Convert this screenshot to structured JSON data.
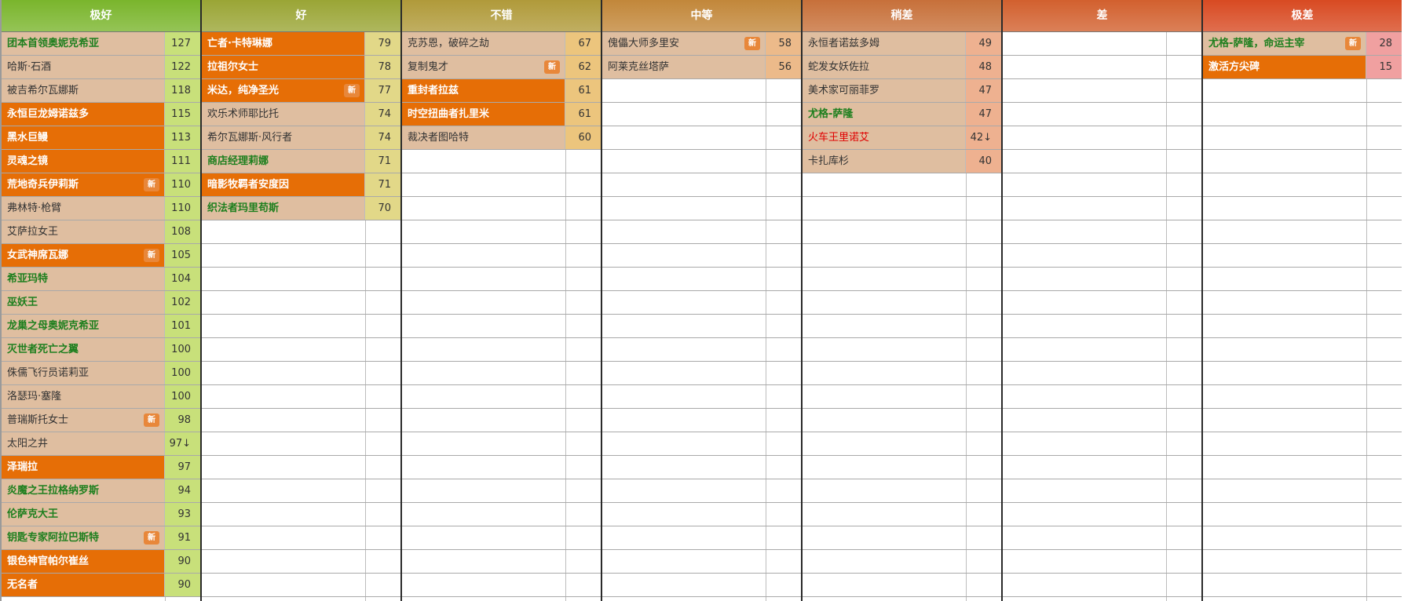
{
  "columns": [
    {
      "title": "极好",
      "header_color": "#7ab52c",
      "score_bg": "#c8e07a",
      "rows": [
        {
          "name": "团本首领奥妮克希亚",
          "score": "127",
          "style": "green"
        },
        {
          "name": "哈斯·石酒",
          "score": "122",
          "style": "regular"
        },
        {
          "name": "被吉希尔瓦娜斯",
          "score": "118",
          "style": "regular"
        },
        {
          "name": "永恒巨龙姆诺兹多",
          "score": "115",
          "style": "orange"
        },
        {
          "name": "黑水巨鳗",
          "score": "113",
          "style": "orange"
        },
        {
          "name": "灵魂之镜",
          "score": "111",
          "style": "orange"
        },
        {
          "name": "荒地奇兵伊莉斯",
          "score": "110",
          "style": "orange",
          "badge": "新"
        },
        {
          "name": "弗林特·枪臂",
          "score": "110",
          "style": "regular"
        },
        {
          "name": "艾萨拉女王",
          "score": "108",
          "style": "regular"
        },
        {
          "name": "女武神席瓦娜",
          "score": "105",
          "style": "orange",
          "badge": "新"
        },
        {
          "name": "希亚玛特",
          "score": "104",
          "style": "green"
        },
        {
          "name": "巫妖王",
          "score": "102",
          "style": "green"
        },
        {
          "name": "龙巢之母奥妮克希亚",
          "score": "101",
          "style": "green"
        },
        {
          "name": "灭世者死亡之翼",
          "score": "100",
          "style": "green"
        },
        {
          "name": "侏儒飞行员诺莉亚",
          "score": "100",
          "style": "regular"
        },
        {
          "name": "洛瑟玛·塞隆",
          "score": "100",
          "style": "regular"
        },
        {
          "name": "普瑞斯托女士",
          "score": "98",
          "style": "regular",
          "badge": "新"
        },
        {
          "name": "太阳之井",
          "score": "97↓",
          "style": "regular"
        },
        {
          "name": "泽瑞拉",
          "score": "97",
          "style": "orange"
        },
        {
          "name": "炎魔之王拉格纳罗斯",
          "score": "94",
          "style": "green"
        },
        {
          "name": "伦萨克大王",
          "score": "93",
          "style": "green"
        },
        {
          "name": "钥匙专家阿拉巴斯特",
          "score": "91",
          "style": "green",
          "badge": "新"
        },
        {
          "name": "银色神官帕尔崔丝",
          "score": "90",
          "style": "orange"
        },
        {
          "name": "无名者",
          "score": "90",
          "style": "orange"
        }
      ]
    },
    {
      "title": "好",
      "header_color": "#9aa535",
      "score_bg": "#e2d888",
      "rows": [
        {
          "name": "亡者·卡特琳娜",
          "score": "79",
          "style": "orange"
        },
        {
          "name": "拉祖尔女士",
          "score": "78",
          "style": "orange"
        },
        {
          "name": "米达，纯净圣光",
          "score": "77",
          "style": "orange",
          "badge": "新"
        },
        {
          "name": "欢乐术师耶比托",
          "score": "74",
          "style": "regular"
        },
        {
          "name": "希尔瓦娜斯·风行者",
          "score": "74",
          "style": "regular"
        },
        {
          "name": "商店经理莉娜",
          "score": "71",
          "style": "green"
        },
        {
          "name": "暗影牧羁者安度因",
          "score": "71",
          "style": "orange"
        },
        {
          "name": "织法者玛里苟斯",
          "score": "70",
          "style": "green"
        }
      ]
    },
    {
      "title": "不错",
      "header_color": "#b09a3a",
      "score_bg": "#ecc57d",
      "rows": [
        {
          "name": "克苏恩，破碎之劫",
          "score": "67",
          "style": "regular"
        },
        {
          "name": "复制鬼才",
          "score": "62",
          "style": "regular",
          "badge": "新"
        },
        {
          "name": "重封者拉兹",
          "score": "61",
          "style": "orange"
        },
        {
          "name": "时空扭曲者扎里米",
          "score": "61",
          "style": "orange"
        },
        {
          "name": "裁决者图哈特",
          "score": "60",
          "style": "regular"
        }
      ]
    },
    {
      "title": "中等",
      "header_color": "#c2873a",
      "score_bg": "#ecba8a",
      "rows": [
        {
          "name": "傀儡大师多里安",
          "score": "58",
          "style": "regular",
          "badge": "新"
        },
        {
          "name": "阿莱克丝塔萨",
          "score": "56",
          "style": "regular"
        }
      ]
    },
    {
      "title": "稍差",
      "header_color": "#c7703a",
      "score_bg": "#eeb190",
      "rows": [
        {
          "name": "永恒者诺兹多姆",
          "score": "49",
          "style": "regular"
        },
        {
          "name": "蛇发女妖佐拉",
          "score": "48",
          "style": "regular"
        },
        {
          "name": "美术家可丽菲罗",
          "score": "47",
          "style": "regular"
        },
        {
          "name": "尤格-萨隆",
          "score": "47",
          "style": "green"
        },
        {
          "name": "火车王里诺艾",
          "score": "42↓",
          "style": "red"
        },
        {
          "name": "卡扎库杉",
          "score": "40",
          "style": "regular"
        }
      ]
    },
    {
      "title": "差",
      "header_color": "#d2602e",
      "score_bg": "#f0a898",
      "rows": []
    },
    {
      "title": "极差",
      "header_color": "#d84a22",
      "score_bg": "#f0a0a0",
      "rows": [
        {
          "name": "尤格-萨隆，命运主宰",
          "score": "28",
          "style": "green",
          "badge": "新"
        },
        {
          "name": "激活方尖碑",
          "score": "15",
          "style": "orange"
        }
      ]
    }
  ]
}
